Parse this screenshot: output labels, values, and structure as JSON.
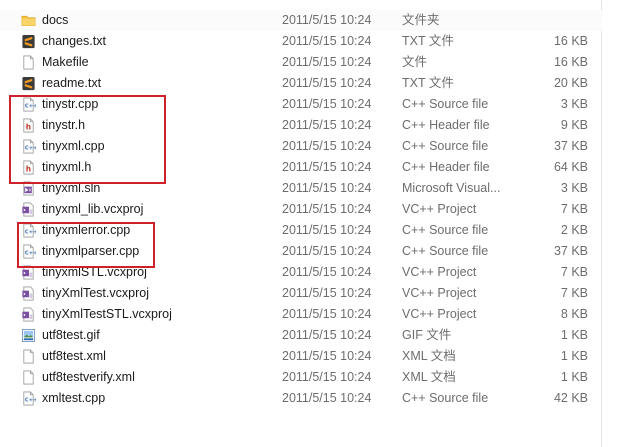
{
  "colors": {
    "folder": "#f5c542",
    "sublime": "#f29a1f",
    "cpp": "#3b6fb6",
    "header": "#c0392b",
    "project": "#7a4fa0",
    "highlight": "#d0202a"
  },
  "files": [
    {
      "name": "docs",
      "date": "2011/5/15 10:24",
      "type": "文件夹",
      "size": "",
      "icon": "folder-icon"
    },
    {
      "name": "changes.txt",
      "date": "2011/5/15 10:24",
      "type": "TXT 文件",
      "size": "16 KB",
      "icon": "sublime-text-icon"
    },
    {
      "name": "Makefile",
      "date": "2011/5/15 10:24",
      "type": "文件",
      "size": "16 KB",
      "icon": "blank-file-icon"
    },
    {
      "name": "readme.txt",
      "date": "2011/5/15 10:24",
      "type": "TXT 文件",
      "size": "20 KB",
      "icon": "sublime-text-icon"
    },
    {
      "name": "tinystr.cpp",
      "date": "2011/5/15 10:24",
      "type": "C++ Source file",
      "size": "3 KB",
      "icon": "cpp-source-icon"
    },
    {
      "name": "tinystr.h",
      "date": "2011/5/15 10:24",
      "type": "C++ Header file",
      "size": "9 KB",
      "icon": "cpp-header-icon"
    },
    {
      "name": "tinyxml.cpp",
      "date": "2011/5/15 10:24",
      "type": "C++ Source file",
      "size": "37 KB",
      "icon": "cpp-source-icon"
    },
    {
      "name": "tinyxml.h",
      "date": "2011/5/15 10:24",
      "type": "C++ Header file",
      "size": "64 KB",
      "icon": "cpp-header-icon"
    },
    {
      "name": "tinyxml.sln",
      "date": "2011/5/15 10:24",
      "type": "Microsoft Visual...",
      "size": "3 KB",
      "icon": "visual-studio-solution-icon"
    },
    {
      "name": "tinyxml_lib.vcxproj",
      "date": "2011/5/15 10:24",
      "type": "VC++ Project",
      "size": "7 KB",
      "icon": "vc-project-icon"
    },
    {
      "name": "tinyxmlerror.cpp",
      "date": "2011/5/15 10:24",
      "type": "C++ Source file",
      "size": "2 KB",
      "icon": "cpp-source-icon"
    },
    {
      "name": "tinyxmlparser.cpp",
      "date": "2011/5/15 10:24",
      "type": "C++ Source file",
      "size": "37 KB",
      "icon": "cpp-source-icon"
    },
    {
      "name": "tinyxmlSTL.vcxproj",
      "date": "2011/5/15 10:24",
      "type": "VC++ Project",
      "size": "7 KB",
      "icon": "vc-project-icon"
    },
    {
      "name": "tinyXmlTest.vcxproj",
      "date": "2011/5/15 10:24",
      "type": "VC++ Project",
      "size": "7 KB",
      "icon": "vc-project-icon"
    },
    {
      "name": "tinyXmlTestSTL.vcxproj",
      "date": "2011/5/15 10:24",
      "type": "VC++ Project",
      "size": "8 KB",
      "icon": "vc-project-icon"
    },
    {
      "name": "utf8test.gif",
      "date": "2011/5/15 10:24",
      "type": "GIF 文件",
      "size": "1 KB",
      "icon": "gif-image-icon"
    },
    {
      "name": "utf8test.xml",
      "date": "2011/5/15 10:24",
      "type": "XML 文档",
      "size": "1 KB",
      "icon": "blank-file-icon"
    },
    {
      "name": "utf8testverify.xml",
      "date": "2011/5/15 10:24",
      "type": "XML 文档",
      "size": "1 KB",
      "icon": "blank-file-icon"
    },
    {
      "name": "xmltest.cpp",
      "date": "2011/5/15 10:24",
      "type": "C++ Source file",
      "size": "42 KB",
      "icon": "cpp-source-icon"
    }
  ]
}
